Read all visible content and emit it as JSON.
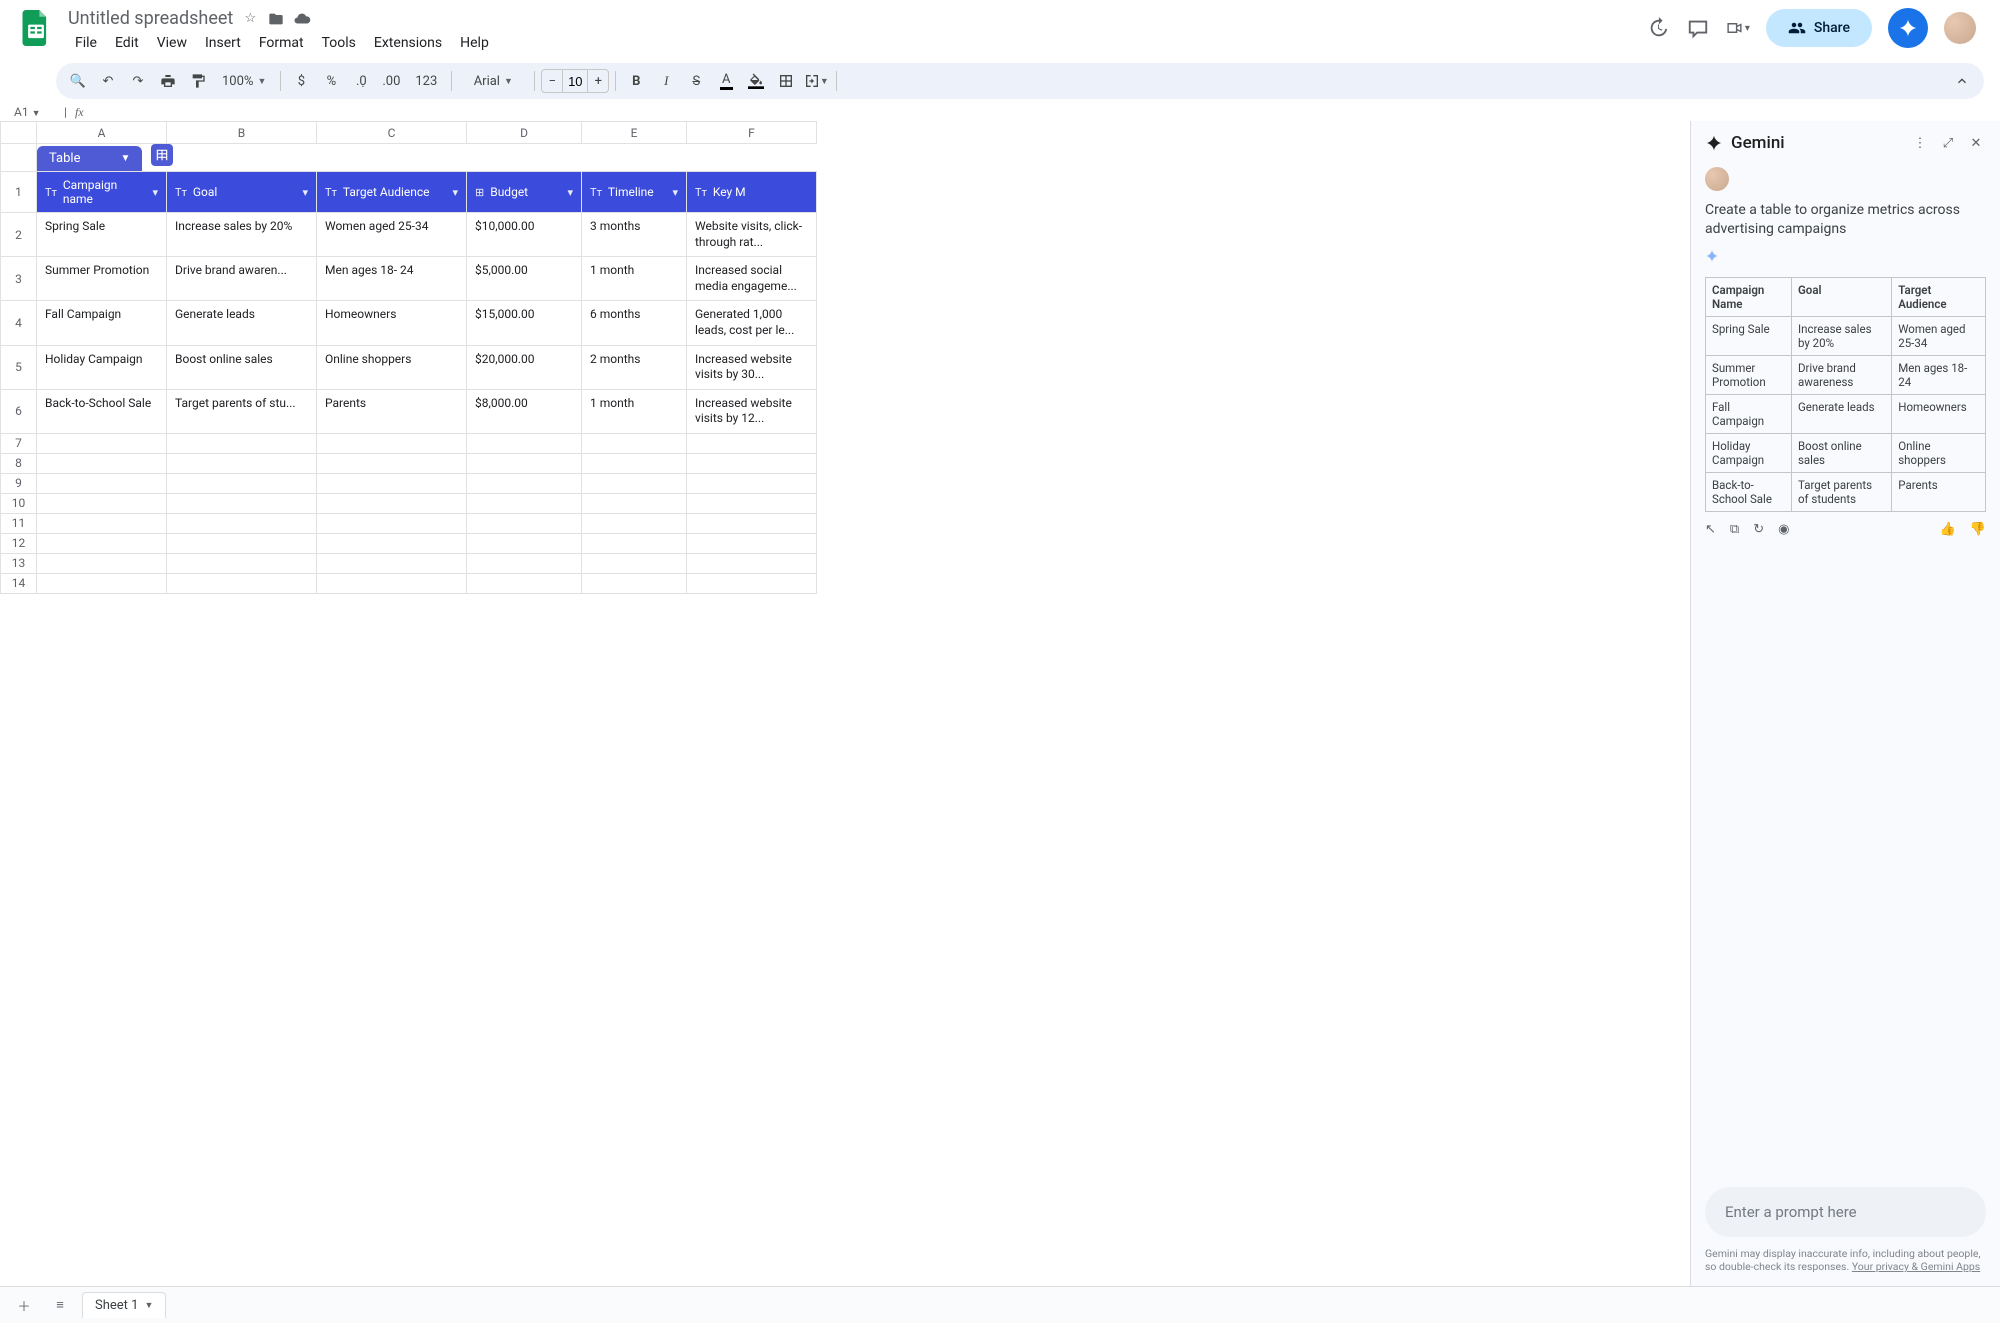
{
  "header": {
    "title": "Untitled spreadsheet",
    "menus": [
      "File",
      "Edit",
      "View",
      "Insert",
      "Format",
      "Tools",
      "Extensions",
      "Help"
    ],
    "share_label": "Share"
  },
  "toolbar": {
    "zoom": "100%",
    "font": "Arial",
    "font_size": "10",
    "number_format": "123"
  },
  "namebox": {
    "ref": "A1"
  },
  "columns": [
    "A",
    "B",
    "C",
    "D",
    "E",
    "F"
  ],
  "table_chip": {
    "label": "Table"
  },
  "sheet_headers": [
    {
      "label": "Campaign name",
      "type": "Tт"
    },
    {
      "label": "Goal",
      "type": "Tт"
    },
    {
      "label": "Target Audience",
      "type": "Tт"
    },
    {
      "label": "Budget",
      "type": "$"
    },
    {
      "label": "Timeline",
      "type": "Tт"
    },
    {
      "label": "Key M",
      "type": "Tт"
    }
  ],
  "rows": [
    {
      "n": 2,
      "cells": [
        "Spring Sale",
        "Increase sales by 20%",
        "Women aged 25-34",
        "$10,000.00",
        "3 months",
        "Website visits, click-through rat..."
      ]
    },
    {
      "n": 3,
      "cells": [
        "Summer Promotion",
        "Drive brand awaren...",
        "Men ages 18- 24",
        "$5,000.00",
        "1 month",
        "Increased social media engageme..."
      ]
    },
    {
      "n": 4,
      "cells": [
        "Fall Campaign",
        "Generate leads",
        "Homeowners",
        "$15,000.00",
        "6 months",
        "Generated 1,000 leads, cost per le..."
      ]
    },
    {
      "n": 5,
      "cells": [
        "Holiday Campaign",
        "Boost online sales",
        "Online shoppers",
        "$20,000.00",
        "2 months",
        "Increased website visits by 30..."
      ]
    },
    {
      "n": 6,
      "cells": [
        "Back-to-School Sale",
        "Target parents of stu...",
        "Parents",
        "$8,000.00",
        "1 month",
        "Increased website visits by 12..."
      ]
    }
  ],
  "empty_rows": [
    7,
    8,
    9,
    10,
    11,
    12,
    13,
    14
  ],
  "sheet_tab": "Sheet 1",
  "gemini": {
    "title": "Gemini",
    "prompt": "Create a table to organize metrics across advertising campaigns",
    "table": {
      "headers": [
        "Campaign Name",
        "Goal",
        "Target Audience"
      ],
      "rows": [
        [
          "Spring Sale",
          "Increase sales by 20%",
          "Women aged 25-34"
        ],
        [
          "Summer Promotion",
          "Drive brand awareness",
          "Men ages 18- 24"
        ],
        [
          "Fall Campaign",
          "Generate leads",
          "Homeowners"
        ],
        [
          "Holiday Campaign",
          "Boost online sales",
          "Online shoppers"
        ],
        [
          "Back-to-School Sale",
          "Target parents of students",
          "Parents"
        ]
      ]
    },
    "input_placeholder": "Enter a prompt here",
    "disclaimer": "Gemini may display inaccurate info, including about people, so double-check its responses.",
    "disclaimer_link": "Your privacy & Gemini Apps"
  }
}
